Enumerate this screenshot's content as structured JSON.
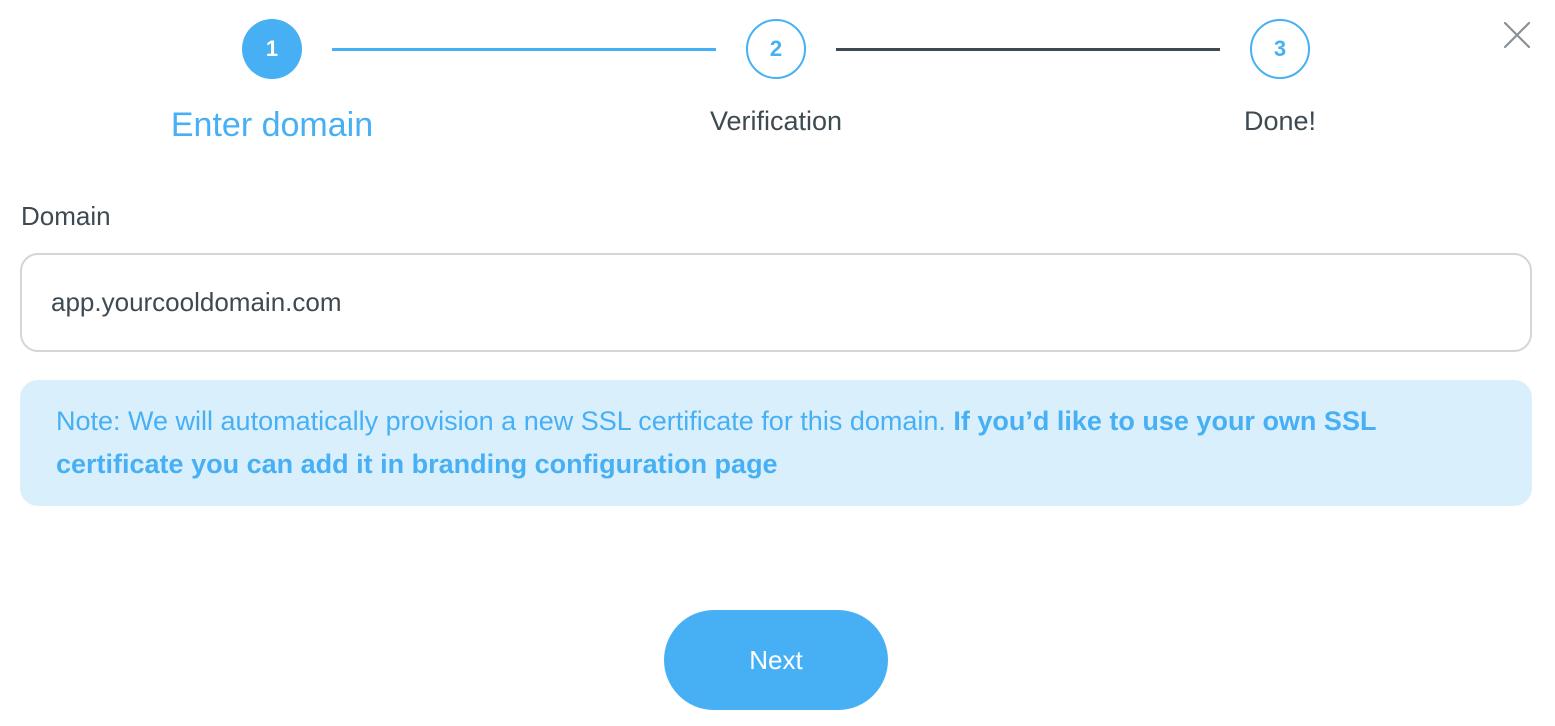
{
  "stepper": {
    "steps": [
      {
        "number": "1",
        "label": "Enter domain",
        "state": "active"
      },
      {
        "number": "2",
        "label": "Verification",
        "state": "pending"
      },
      {
        "number": "3",
        "label": "Done!",
        "state": "pending"
      }
    ]
  },
  "form": {
    "domain_label": "Domain",
    "domain_value": "app.yourcooldomain.com"
  },
  "note": {
    "text": "Note: We will automatically provision a new SSL certificate for this domain. ",
    "bold_text": "If you’d like to use your own SSL certificate you can add it in branding configuration page"
  },
  "actions": {
    "next_label": "Next",
    "close_icon": "close-icon"
  },
  "colors": {
    "accent": "#47b0f5",
    "text": "#3e4a51",
    "note_bg": "#daeffc",
    "border": "#d3d6d9"
  }
}
